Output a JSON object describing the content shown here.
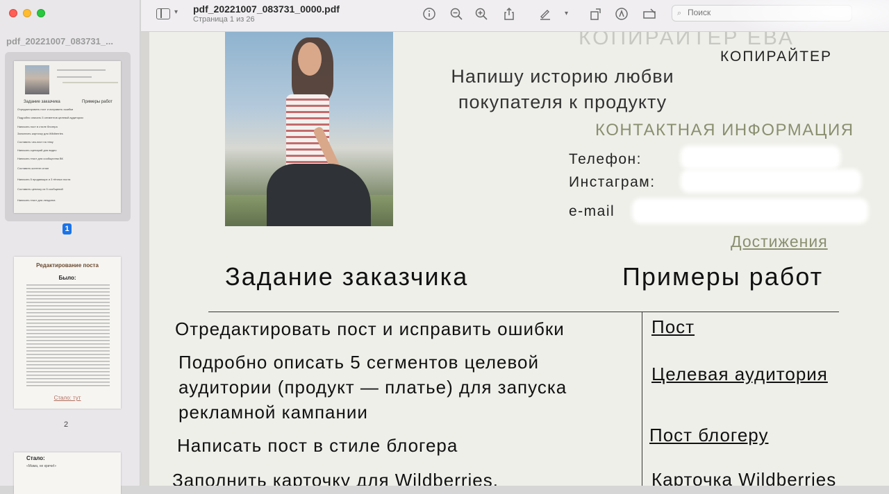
{
  "window": {
    "doc_title": "pdf_20221007_083731_0000.pdf",
    "page_info": "Страница 1 из 26"
  },
  "search": {
    "placeholder": "Поиск"
  },
  "sidebar": {
    "title": "pdf_20221007_083731_...",
    "page1_number": "1",
    "page2_number": "2",
    "thumb1": {
      "heading_left": "Задание заказчика",
      "heading_right": "Примеры работ",
      "rows": [
        "Отредактировать пост и исправить ошибки",
        "Подробно описать 5 сегментов целевой аудитории",
        "Написать пост в стиле блогера",
        "Заполнить карточку для Wildberries",
        "Составить чек-лист на тему",
        "Написать сценарий для видео",
        "Написать текст для сообщества ВК",
        "Составить контент-план",
        "Написать 5 продающих и 3 тёплых поста",
        "Составить цепочку из 5 сообщений",
        "Написать текст для лендинга"
      ]
    },
    "thumb2": {
      "title": "Редактирование поста",
      "subtitle": "Было:",
      "link": "Стало: тут"
    },
    "thumb3": {
      "title": "Стало:",
      "line": "«Мама, не кричи!»"
    }
  },
  "page": {
    "faded_name": "КОПИРАЙТЕР ЕВА",
    "role": "КОПИРАЙТЕР",
    "slogan": "Напишу историю любви покупателя к продукту",
    "contact_heading": "КОНТАКТНАЯ ИНФОРМАЦИЯ",
    "phone_label": "Телефон:",
    "instagram_label": "Инстаграм:",
    "email_label": "e-mail",
    "achievements_link": "Достижения",
    "col_task_heading": "Задание заказчика",
    "col_examples_heading": "Примеры работ",
    "tasks": [
      "Отредактировать пост и исправить ошибки",
      "Подробно описать 5 сегментов целевой аудитории (продукт — платье) для запуска рекламной кампании",
      "Написать пост в стиле блогера",
      "Заполнить карточку для Wildberries."
    ],
    "examples": [
      "Пост",
      "Целевая аудитория",
      "Пост блогеру",
      "Карточка Wildberries"
    ]
  },
  "colors": {
    "accent_olive": "#8a8f6f",
    "selection_blue": "#1a73e8"
  }
}
